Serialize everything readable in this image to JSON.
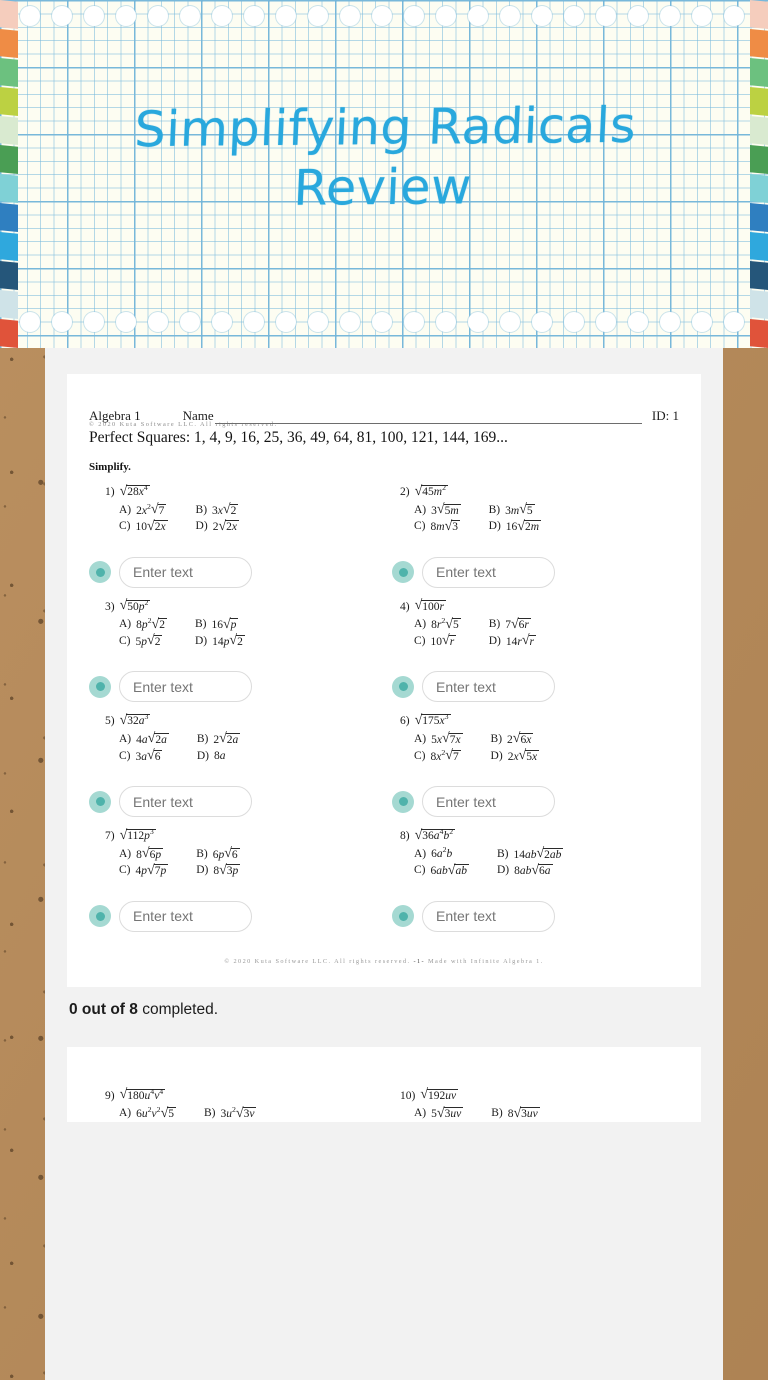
{
  "banner": {
    "title_line1": "Simplifying Radicals",
    "title_line2": "Review",
    "accent_color": "#29a8dd",
    "paper_color": "#fdfdf2"
  },
  "worksheet": {
    "course": "Algebra 1",
    "name_label": "Name",
    "id_label": "ID: 1",
    "copyright_top": "© 2020 Kuta Software LLC.  All rights reserved.",
    "perfect_squares": "Perfect Squares: 1, 4, 9, 16, 25, 36, 49, 64, 81, 100, 121, 144, 169...",
    "directions": "Simplify.",
    "copyright_bottom_left": "© 2020 Kuta Software LLC.  All rights reserved.",
    "page_number": "-1-",
    "copyright_bottom_right": "Made with Infinite Algebra 1.",
    "progress_count": "0 out of 8",
    "progress_suffix": " completed."
  },
  "input": {
    "placeholder": "Enter text",
    "value": "",
    "bullet_color": "#a5d9d2",
    "bullet_dot_color": "#4fb3ab"
  },
  "problems": [
    {
      "number": "1)",
      "expr_radicand": "28x⁴",
      "choices": [
        {
          "label": "A)",
          "text": "2x²√7"
        },
        {
          "label": "B)",
          "text": "3x√2"
        },
        {
          "label": "C)",
          "text": "10√(2x)"
        },
        {
          "label": "D)",
          "text": "2√(2x)"
        }
      ]
    },
    {
      "number": "2)",
      "expr_radicand": "45m²",
      "choices": [
        {
          "label": "A)",
          "text": "3√(5m)"
        },
        {
          "label": "B)",
          "text": "3m√5"
        },
        {
          "label": "C)",
          "text": "8m√3"
        },
        {
          "label": "D)",
          "text": "16√(2m)"
        }
      ]
    },
    {
      "number": "3)",
      "expr_radicand": "50p²",
      "choices": [
        {
          "label": "A)",
          "text": "8p²√2"
        },
        {
          "label": "B)",
          "text": "16√p"
        },
        {
          "label": "C)",
          "text": "5p√2"
        },
        {
          "label": "D)",
          "text": "14p√2"
        }
      ]
    },
    {
      "number": "4)",
      "expr_radicand": "100r",
      "choices": [
        {
          "label": "A)",
          "text": "8r²√5"
        },
        {
          "label": "B)",
          "text": "7√(6r)"
        },
        {
          "label": "C)",
          "text": "10√r"
        },
        {
          "label": "D)",
          "text": "14r√r"
        }
      ]
    },
    {
      "number": "5)",
      "expr_radicand": "32a³",
      "choices": [
        {
          "label": "A)",
          "text": "4a√(2a)"
        },
        {
          "label": "B)",
          "text": "2√(2a)"
        },
        {
          "label": "C)",
          "text": "3a√6"
        },
        {
          "label": "D)",
          "text": "8a"
        }
      ]
    },
    {
      "number": "6)",
      "expr_radicand": "175x³",
      "choices": [
        {
          "label": "A)",
          "text": "5x√(7x)"
        },
        {
          "label": "B)",
          "text": "2√(6x)"
        },
        {
          "label": "C)",
          "text": "8x²√7"
        },
        {
          "label": "D)",
          "text": "2x√(5x)"
        }
      ]
    },
    {
      "number": "7)",
      "expr_radicand": "112p³",
      "choices": [
        {
          "label": "A)",
          "text": "8√(6p)"
        },
        {
          "label": "B)",
          "text": "6p√6"
        },
        {
          "label": "C)",
          "text": "4p√(7p)"
        },
        {
          "label": "D)",
          "text": "8√(3p)"
        }
      ]
    },
    {
      "number": "8)",
      "expr_radicand": "36a⁴b²",
      "choices": [
        {
          "label": "A)",
          "text": "6a²b"
        },
        {
          "label": "B)",
          "text": "14ab√(2ab)"
        },
        {
          "label": "C)",
          "text": "6ab√(ab)"
        },
        {
          "label": "D)",
          "text": "8ab√(6a)"
        }
      ]
    },
    {
      "number": "9)",
      "expr_radicand": "180u⁴v⁴",
      "choices": [
        {
          "label": "A)",
          "text": "6u²v²√5"
        },
        {
          "label": "B)",
          "text": "3u²√(3v)"
        }
      ]
    },
    {
      "number": "10)",
      "expr_radicand": "192uv",
      "choices": [
        {
          "label": "A)",
          "text": "5√(3uv)"
        },
        {
          "label": "B)",
          "text": "8√(3uv)"
        }
      ]
    }
  ]
}
